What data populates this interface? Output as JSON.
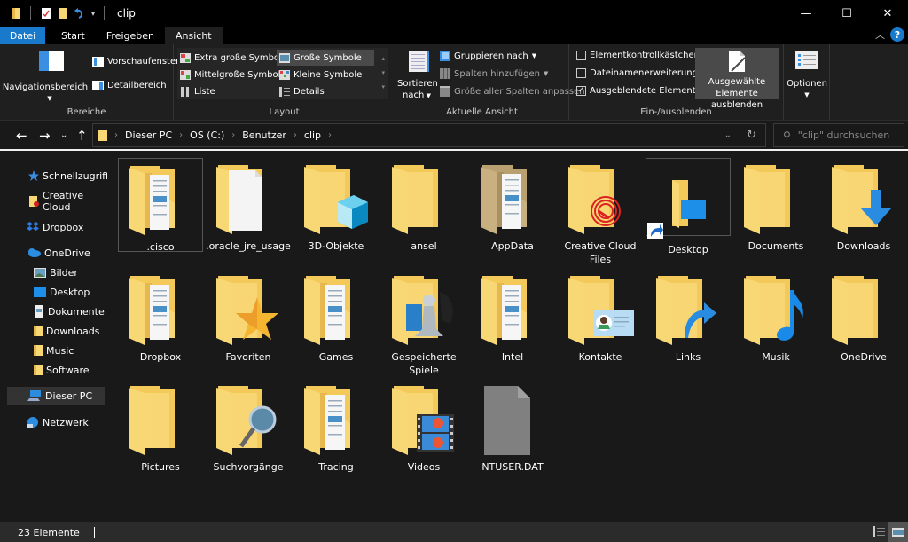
{
  "titlebar": {
    "title": "clip",
    "quick_access": [
      "folder-icon",
      "properties-icon",
      "new-folder-icon",
      "undo-icon",
      "customize-dropdown-icon"
    ],
    "buttons": {
      "minimize": "—",
      "maximize": "☐",
      "close": "✕"
    }
  },
  "tabs": [
    {
      "label": "Datei"
    },
    {
      "label": "Start"
    },
    {
      "label": "Freigeben"
    },
    {
      "label": "Ansicht"
    }
  ],
  "ribbon": {
    "bereiche": {
      "label": "Bereiche",
      "navigationsbereich": "Navigationsbereich",
      "vorschaufenster": "Vorschaufenster",
      "detailbereich": "Detailbereich"
    },
    "layout": {
      "label": "Layout",
      "items": [
        {
          "label": "Extra große Symbole",
          "selected": false
        },
        {
          "label": "Große Symbole",
          "selected": true
        },
        {
          "label": "Mittelgroße Symbole",
          "selected": false
        },
        {
          "label": "Kleine Symbole",
          "selected": false
        },
        {
          "label": "Liste",
          "selected": false
        },
        {
          "label": "Details",
          "selected": false
        }
      ]
    },
    "aktuelle_ansicht": {
      "label": "Aktuelle Ansicht",
      "sortieren_line1": "Sortieren",
      "sortieren_line2": "nach",
      "gruppieren": "Gruppieren nach",
      "spalten": "Spalten hinzufügen",
      "groesse": "Größe aller Spalten anpassen"
    },
    "ein_aus": {
      "label": "Ein-/ausblenden",
      "checkboxes": [
        {
          "label": "Elementkontrollkästchen",
          "checked": false
        },
        {
          "label": "Dateinamenerweiterungen",
          "checked": false
        },
        {
          "label": "Ausgeblendete Elemente",
          "checked": true
        }
      ],
      "ausblenden_line1": "Ausgewählte",
      "ausblenden_line2": "Elemente ausblenden"
    },
    "optionen": {
      "label": "Optionen"
    }
  },
  "navigation": {
    "breadcrumb": [
      "Dieser PC",
      "OS (C:)",
      "Benutzer",
      "clip"
    ],
    "search_placeholder": "\"clip\" durchsuchen"
  },
  "sidebar": {
    "items": [
      {
        "label": "Schnellzugriff",
        "icon": "star-icon"
      },
      {
        "label": "Creative Cloud",
        "icon": "creative-cloud-folder-icon"
      },
      {
        "label": "Dropbox",
        "icon": "dropbox-icon"
      },
      {
        "label": "OneDrive",
        "icon": "onedrive-cloud-icon"
      },
      {
        "label": "Bilder",
        "icon": "pictures-icon"
      },
      {
        "label": "Desktop",
        "icon": "desktop-icon"
      },
      {
        "label": "Dokumente",
        "icon": "documents-icon"
      },
      {
        "label": "Downloads",
        "icon": "folder-icon"
      },
      {
        "label": "Music",
        "icon": "folder-icon"
      },
      {
        "label": "Software",
        "icon": "folder-icon"
      },
      {
        "label": "Dieser PC",
        "icon": "this-pc-icon",
        "selected": true
      },
      {
        "label": "Netzwerk",
        "icon": "network-icon"
      }
    ]
  },
  "files": [
    {
      "name": ".cisco",
      "type": "folder-docs"
    },
    {
      "name": ".oracle_jre_usage",
      "type": "folder-white"
    },
    {
      "name": "3D-Objekte",
      "type": "folder-3d"
    },
    {
      "name": "ansel",
      "type": "folder"
    },
    {
      "name": "AppData",
      "type": "folder-hidden"
    },
    {
      "name": "Creative Cloud Files",
      "type": "folder-cc"
    },
    {
      "name": "Desktop",
      "type": "shortcut-desktop"
    },
    {
      "name": "Documents",
      "type": "folder"
    },
    {
      "name": "Downloads",
      "type": "folder-downloads"
    },
    {
      "name": "Dropbox",
      "type": "folder-docs"
    },
    {
      "name": "Favoriten",
      "type": "folder-star"
    },
    {
      "name": "Games",
      "type": "folder-docs"
    },
    {
      "name": "Gespeicherte Spiele",
      "type": "folder-games"
    },
    {
      "name": "Intel",
      "type": "folder-docs"
    },
    {
      "name": "Kontakte",
      "type": "folder-contacts"
    },
    {
      "name": "Links",
      "type": "folder-links"
    },
    {
      "name": "Musik",
      "type": "folder-music"
    },
    {
      "name": "OneDrive",
      "type": "folder"
    },
    {
      "name": "Pictures",
      "type": "folder"
    },
    {
      "name": "Suchvorgänge",
      "type": "folder-search"
    },
    {
      "name": "Tracing",
      "type": "folder-docs"
    },
    {
      "name": "Videos",
      "type": "folder-videos"
    },
    {
      "name": "NTUSER.DAT",
      "type": "file-hidden"
    }
  ],
  "status": {
    "count": "23 Elemente"
  },
  "colors": {
    "accent": "#1979ca",
    "folder": "#f8d775",
    "background": "#191919"
  }
}
